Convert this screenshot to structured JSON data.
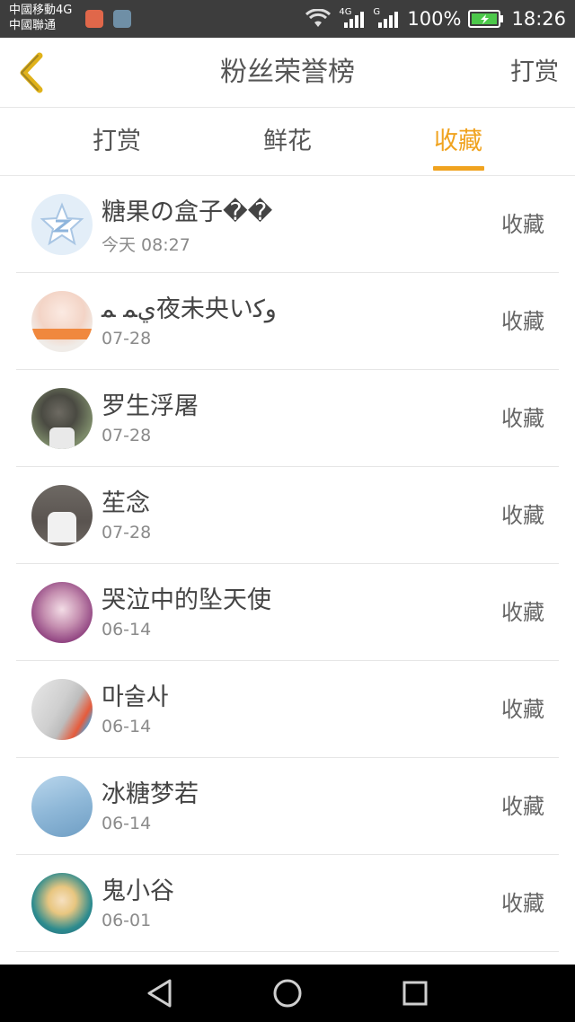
{
  "status_bar": {
    "carrier_line1": "中國移動4G",
    "carrier_line2": "中國聯通",
    "network_1": "4G",
    "network_2": "G",
    "battery": "100%",
    "time": "18:26"
  },
  "header": {
    "back_icon": "chevron-left-icon",
    "title": "粉丝荣誉榜",
    "action": "打赏",
    "accent_color": "#f0a31f"
  },
  "tabs": [
    {
      "label": "打赏",
      "active": false
    },
    {
      "label": "鲜花",
      "active": false
    },
    {
      "label": "收藏",
      "active": true
    }
  ],
  "list": [
    {
      "name": "糖果の盒子��",
      "date": "今天 08:27",
      "action": "收藏"
    },
    {
      "name": "يﻤ ﻤ夜未央いوﮐ",
      "date": "07-28",
      "action": "收藏"
    },
    {
      "name": "罗生浮屠",
      "date": "07-28",
      "action": "收藏"
    },
    {
      "name": "苼念",
      "date": "07-28",
      "action": "收藏"
    },
    {
      "name": "哭泣中的坠天使",
      "date": "06-14",
      "action": "收藏"
    },
    {
      "name": "마술사",
      "date": "06-14",
      "action": "收藏"
    },
    {
      "name": "冰糖梦若",
      "date": "06-14",
      "action": "收藏"
    },
    {
      "name": "鬼小谷",
      "date": "06-01",
      "action": "收藏"
    }
  ]
}
